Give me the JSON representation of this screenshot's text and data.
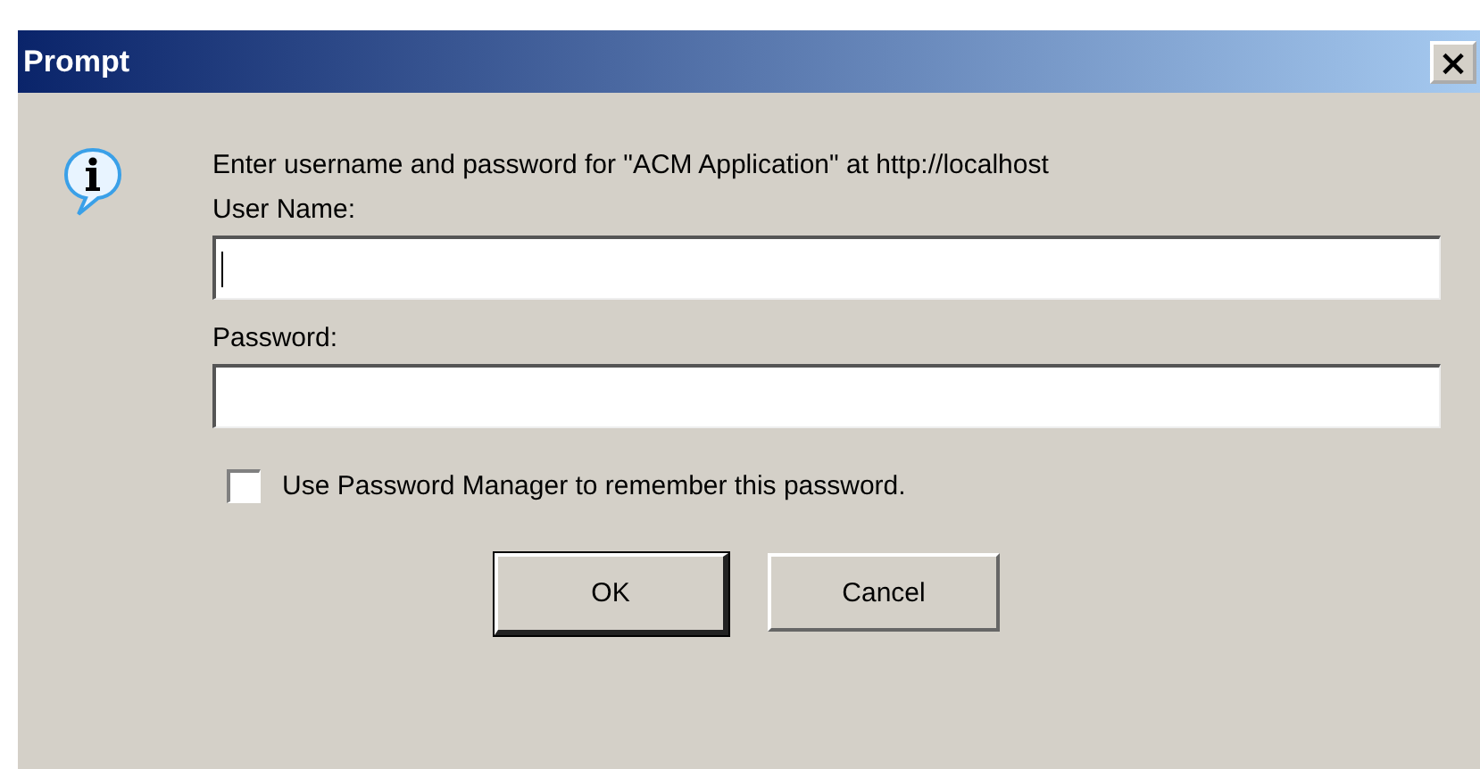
{
  "window": {
    "title": "Prompt",
    "close": "×"
  },
  "message": "Enter username and password for \"ACM Application\" at http://localhost",
  "fields": [
    {
      "label": "User Name:",
      "focused": true
    },
    {
      "label": "Password:",
      "focused": false
    }
  ],
  "remember": {
    "label": "Use Password Manager to remember this password.",
    "checked": false
  },
  "buttons": [
    {
      "label": "OK",
      "default": true
    },
    {
      "label": "Cancel",
      "default": false
    }
  ]
}
